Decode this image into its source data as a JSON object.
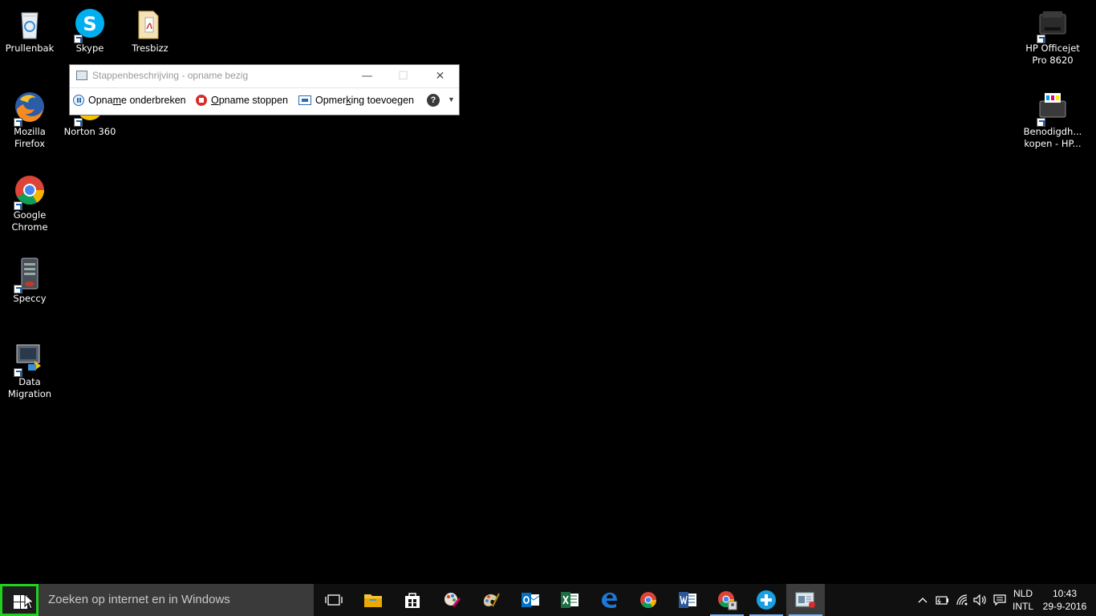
{
  "desktop": {
    "icons": [
      {
        "label": "Prullenbak",
        "icon": "recycle-bin-icon"
      },
      {
        "label": "Skype",
        "icon": "skype-icon"
      },
      {
        "label": "Tresbizz",
        "icon": "folder-pdf-icon"
      },
      {
        "label": "Mozilla Firefox",
        "icon": "firefox-icon"
      },
      {
        "label": "Norton 360",
        "icon": "norton-icon"
      },
      {
        "label": "Google Chrome",
        "icon": "chrome-icon"
      },
      {
        "label": "Speccy",
        "icon": "speccy-icon"
      },
      {
        "label": "Data Migration",
        "icon": "data-migration-icon"
      },
      {
        "label": "HP Officejet Pro 8620",
        "icon": "printer-icon"
      },
      {
        "label": "Benodigdh... kopen - HP...",
        "icon": "printer-supplies-icon"
      }
    ]
  },
  "psr": {
    "title": "Stappenbeschrijving - opname bezig",
    "pause_pre": "Opna",
    "pause_u": "m",
    "pause_post": "e onderbreken",
    "stop_u": "O",
    "stop_post": "pname stoppen",
    "note_pre": "Opmer",
    "note_u": "k",
    "note_post": "ing toevoegen",
    "help": "?"
  },
  "taskbar": {
    "search_placeholder": "Zoeken op internet en in Windows",
    "apps": [
      "task-view-icon",
      "file-explorer-icon",
      "store-icon",
      "paint-icon",
      "paint-palette-icon",
      "outlook-icon",
      "excel-icon",
      "edge-icon",
      "chrome-icon",
      "word-icon",
      "chrome-user-icon",
      "plus-app-icon",
      "steps-recorder-icon"
    ],
    "lang_1": "NLD",
    "lang_2": "INTL",
    "time": "10:43",
    "date": "29-9-2016"
  },
  "colors": {
    "highlight": "#22d11f",
    "accent": "#7ab3ef"
  }
}
